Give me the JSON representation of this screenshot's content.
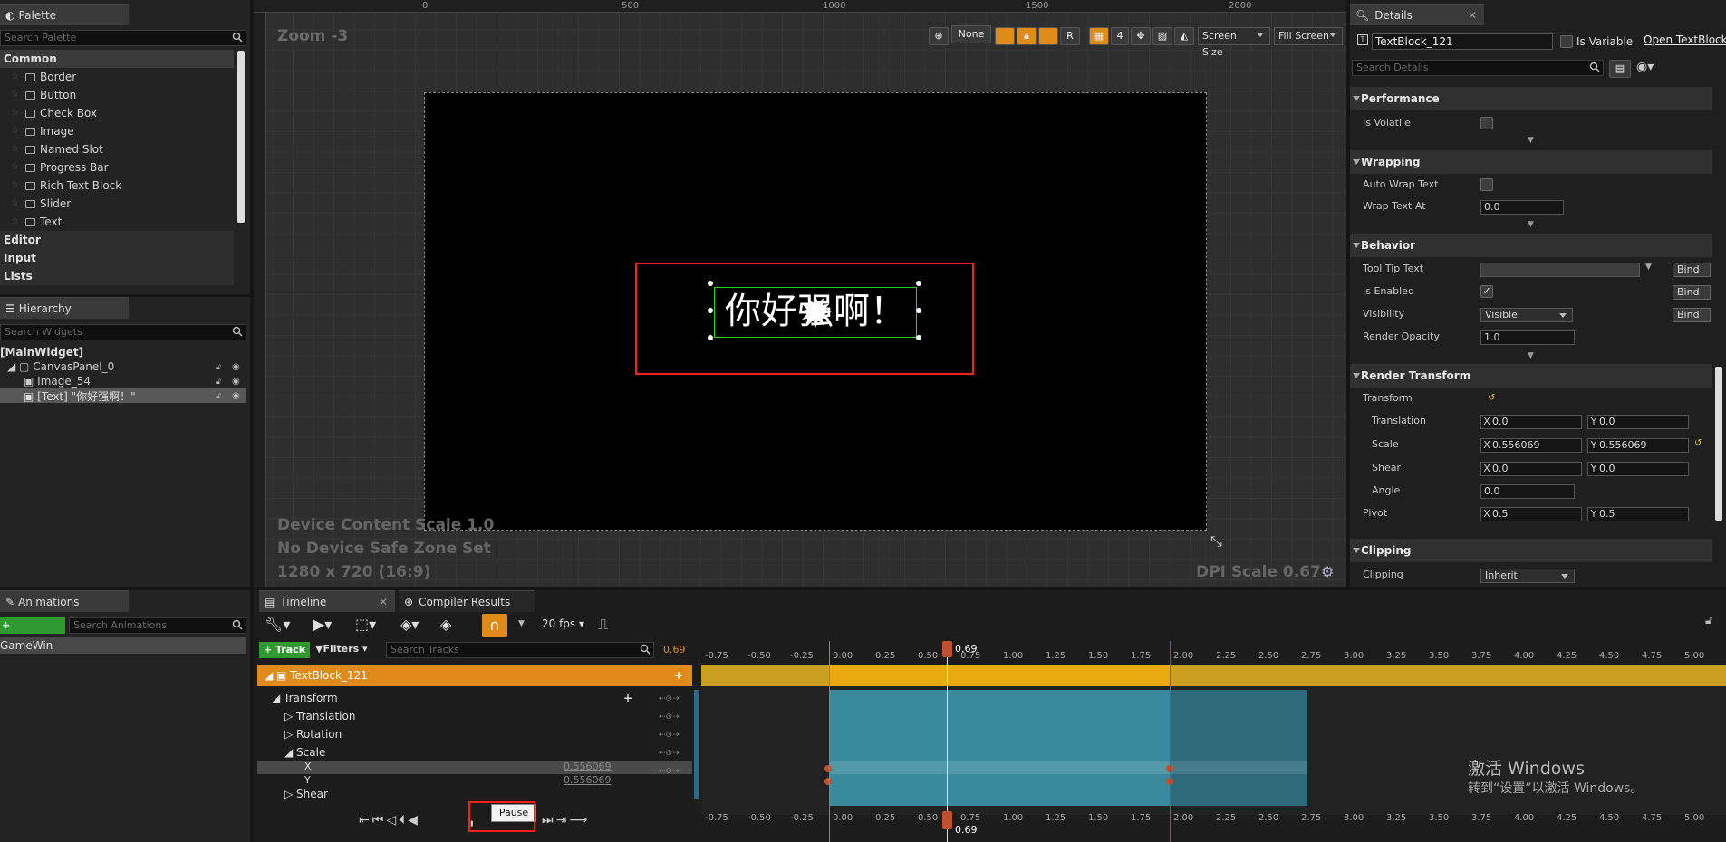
{
  "palette": {
    "tab_title": "Palette",
    "search_placeholder": "Search Palette",
    "category_common": "Common",
    "items": [
      "Border",
      "Button",
      "Check Box",
      "Image",
      "Named Slot",
      "Progress Bar",
      "Rich Text Block",
      "Slider",
      "Text"
    ],
    "categories": [
      "Editor",
      "Input",
      "Lists"
    ]
  },
  "hierarchy": {
    "tab_title": "Hierarchy",
    "search_placeholder": "Search Widgets",
    "root": "[MainWidget]",
    "canvas": "CanvasPanel_0",
    "image": "Image_54",
    "text": "[Text] \"你好强啊！\""
  },
  "designer": {
    "zoom": "Zoom -3",
    "ruler_top": [
      "0",
      "500",
      "1000",
      "1500",
      "2000"
    ],
    "none_btn": "None",
    "r_btn": "R",
    "grid_num": "4",
    "screen_size": "Screen Size",
    "fill_screen": "Fill Screen",
    "canvas_text": "你好强啊！",
    "device_scale": "Device Content Scale 1.0",
    "safe_zone": "No Device Safe Zone Set",
    "resolution": "1280 x 720 (16:9)",
    "dpi_scale": "DPI Scale 0.67"
  },
  "details": {
    "tab_title": "Details",
    "name_value": "TextBlock_121",
    "is_variable": "Is Variable",
    "open_btn": "Open TextBlock",
    "search_placeholder": "Search Details",
    "sec_performance": "Performance",
    "is_volatile": "Is Volatile",
    "sec_wrapping": "Wrapping",
    "auto_wrap": "Auto Wrap Text",
    "wrap_at": "Wrap Text At",
    "wrap_at_value": "0.0",
    "sec_behavior": "Behavior",
    "tooltip": "Tool Tip Text",
    "is_enabled": "Is Enabled",
    "visibility": "Visibility",
    "visibility_value": "Visible",
    "render_opacity": "Render Opacity",
    "render_opacity_value": "1.0",
    "bind": "Bind",
    "sec_render": "Render Transform",
    "transform": "Transform",
    "translation": "Translation",
    "scale": "Scale",
    "shear": "Shear",
    "angle": "Angle",
    "pivot": "Pivot",
    "tx": "0.0",
    "ty": "0.0",
    "sx": "0.556069",
    "sy": "0.556069",
    "shx": "0.0",
    "shy": "0.0",
    "angle_value": "0.0",
    "px": "0.5",
    "py": "0.5",
    "sec_clipping": "Clipping",
    "clipping": "Clipping",
    "clipping_value": "Inherit"
  },
  "animations": {
    "tab_title": "Animations",
    "add_btn": "+ Animation",
    "search_placeholder": "Search Animations",
    "item": "GameWin"
  },
  "timeline": {
    "tab_title": "Timeline",
    "compiler_tab": "Compiler Results",
    "fps": "20 fps",
    "track_btn": "+ Track",
    "filters_btn": "Filters",
    "search_placeholder": "Search Tracks",
    "current_time": "0.69",
    "track_name": "TextBlock_121",
    "transform": "Transform",
    "translation": "Translation",
    "rotation": "Rotation",
    "scale": "Scale",
    "x": "X",
    "y": "Y",
    "x_value": "0.556069",
    "y_value": "0.556069",
    "shear": "Shear",
    "pause_tooltip": "Pause",
    "ticks": [
      "-0.75",
      "-0.50",
      "-0.25",
      "0.00",
      "0.25",
      "0.50",
      "0.75",
      "1.00",
      "1.25",
      "1.50",
      "1.75",
      "2.00",
      "2.25",
      "2.50",
      "2.75",
      "3.00",
      "3.25",
      "3.50",
      "3.75",
      "4.00",
      "4.25",
      "4.50",
      "4.75",
      "5.00"
    ]
  },
  "watermark": {
    "line1": "激活 Windows",
    "line2": "转到“设置”以激活 Windows。"
  }
}
